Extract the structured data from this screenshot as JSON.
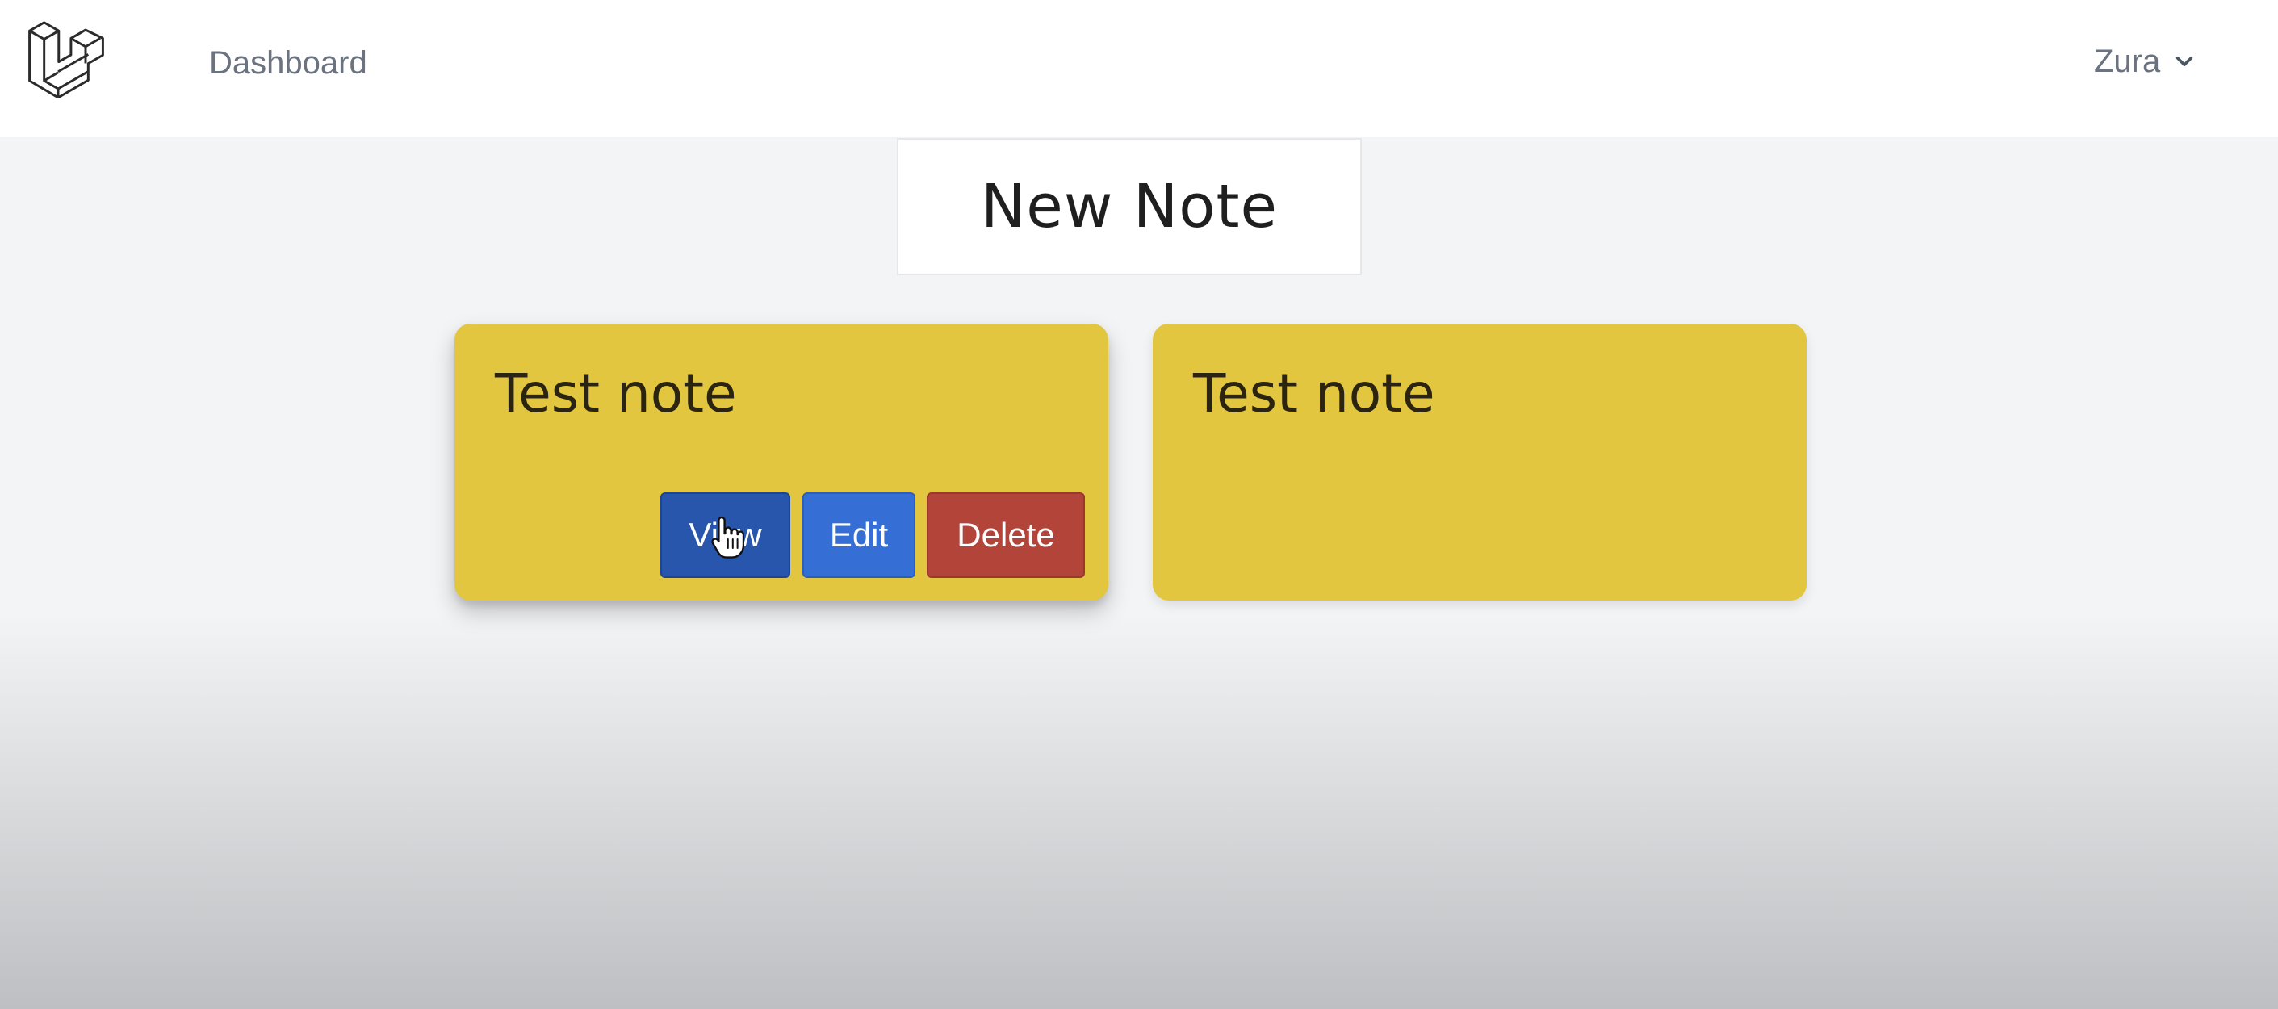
{
  "nav": {
    "dashboard_label": "Dashboard",
    "user_name": "Zura",
    "logo_icon": "laravel-logo-icon",
    "chevron_icon": "chevron-down-icon"
  },
  "actions": {
    "new_note_label": "New Note"
  },
  "notes": [
    {
      "title": "Test note",
      "view_label": "View",
      "edit_label": "Edit",
      "delete_label": "Delete"
    },
    {
      "title": "Test note"
    }
  ],
  "colors": {
    "note_background": "#e2c640",
    "view_button": "#2856ad",
    "edit_button": "#356fd6",
    "delete_button": "#b2443a"
  }
}
